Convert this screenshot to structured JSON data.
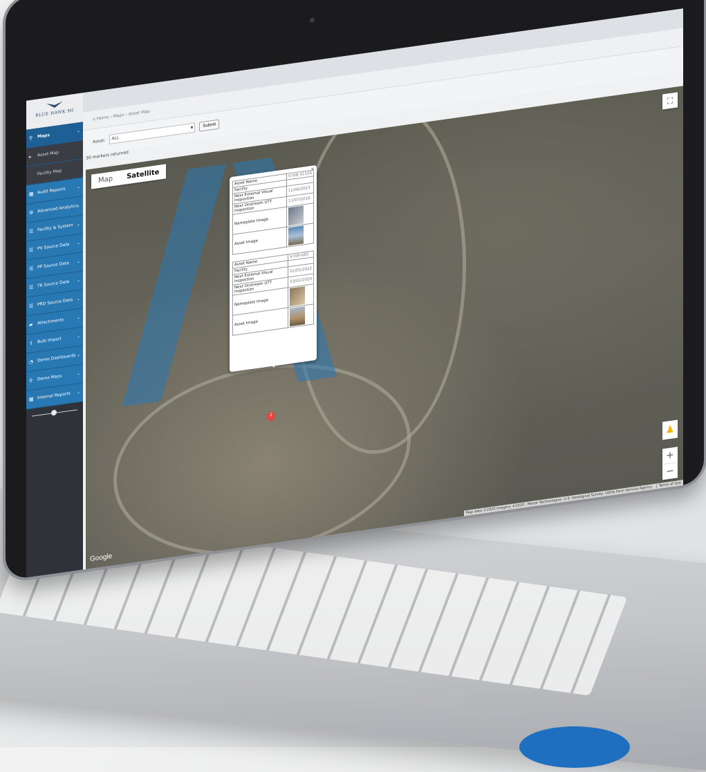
{
  "brand": {
    "name": "BLUE HAWK MI"
  },
  "sidebar": {
    "items": [
      {
        "label": "Maps",
        "icon": "map-pin-icon"
      },
      {
        "label": "Asset Map",
        "icon": "chevron-right-icon"
      },
      {
        "label": "Facility Map"
      },
      {
        "label": "Audit Reports",
        "icon": "grid-icon"
      },
      {
        "label": "Advanced Analytics",
        "icon": "gears-icon"
      },
      {
        "label": "Facility & System",
        "icon": "list-icon"
      },
      {
        "label": "PV Source Data",
        "icon": "list-icon"
      },
      {
        "label": "PP Source Data",
        "icon": "list-icon"
      },
      {
        "label": "TK Source Data",
        "icon": "list-icon"
      },
      {
        "label": "PRD Source Data",
        "icon": "list-icon"
      },
      {
        "label": "Attachments",
        "icon": "folder-icon"
      },
      {
        "label": "Bulk Import",
        "icon": "upload-icon"
      },
      {
        "label": "Demo Dashboards",
        "icon": "dashboard-icon"
      },
      {
        "label": "Demo Maps",
        "icon": "map-pin-icon"
      },
      {
        "label": "Internal Reports",
        "icon": "grid-icon"
      }
    ]
  },
  "breadcrumb": {
    "home": "Home",
    "section": "Maps",
    "page": "Asset Map",
    "separator": "›"
  },
  "filter": {
    "label": "Asset:",
    "value": "ALL",
    "submit": "Submit"
  },
  "markers_text": "30 markers returned",
  "map": {
    "toggle": {
      "map": "Map",
      "satellite": "Satellite"
    },
    "google": "Google",
    "attribution": "Map data ©2020 Imagery ©2020 , Maxar Technologies, U.S. Geological Survey, USDA Farm Service Agency",
    "terms": "Terms of Use",
    "zoom_in": "+",
    "zoom_out": "−",
    "marker_label": "2"
  },
  "infowindow": {
    "close": "×",
    "assets": [
      {
        "asset_name_label": "Asset Name",
        "asset_name": "V-IVB-31156",
        "facility_label": "Facility",
        "next_visual_label": "Next External Visual Inspection",
        "next_visual": "12/06/2023",
        "next_utt_label": "Next Onstream UTT Inspection",
        "next_utt": "11/07/2018",
        "nameplate_label": "Nameplate Image",
        "asset_image_label": "Asset Image"
      },
      {
        "asset_name_label": "Asset Name",
        "asset_name": "V-IVB-665",
        "facility_label": "Facility",
        "next_visual_label": "Next External Visual Inspection",
        "next_visual": "01/05/2022",
        "next_utt_label": "Next Onstream UTT Inspection",
        "next_utt": "03/02/2020",
        "nameplate_label": "Nameplate Image",
        "asset_image_label": "Asset Image"
      }
    ]
  },
  "colors": {
    "accent": "#2878b4",
    "sidebar": "#2f3238",
    "marker": "#e4443b"
  }
}
